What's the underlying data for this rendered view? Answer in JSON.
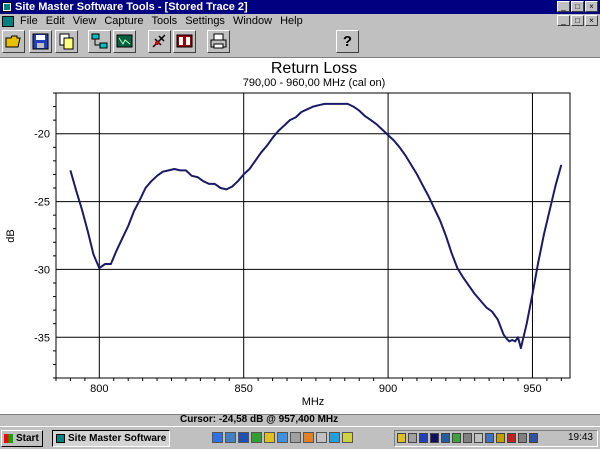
{
  "window": {
    "title": "Site Master Software Tools - [Stored Trace 2]"
  },
  "menu": {
    "items": [
      "File",
      "Edit",
      "View",
      "Capture",
      "Tools",
      "Settings",
      "Window",
      "Help"
    ]
  },
  "toolbar": {
    "buttons": [
      "open-folder-icon",
      "save-disk-icon",
      "copy-icon",
      "network-icon",
      "display-icon",
      "satellite-icon",
      "record-icon",
      "print-icon"
    ],
    "help_label": "?"
  },
  "chart_data": {
    "type": "line",
    "title": "Return Loss",
    "subtitle": "790,00 - 960,00 MHz (cal on)",
    "xlabel": "MHz",
    "ylabel": "dB",
    "xlim": [
      785,
      963
    ],
    "ylim": [
      -38,
      -17
    ],
    "xticks": [
      800,
      850,
      900,
      950
    ],
    "yticks": [
      -20,
      -25,
      -30,
      -35
    ],
    "grid": true,
    "line_color": "#1a1a66",
    "series": [
      {
        "x": [
          790,
          792,
          794,
          796,
          798,
          800,
          802,
          804,
          806,
          808,
          810,
          812,
          814,
          816,
          818,
          820,
          822,
          824,
          826,
          828,
          830,
          832,
          834,
          836,
          838,
          840,
          842,
          844,
          846,
          848,
          850,
          852,
          854,
          856,
          858,
          860,
          862,
          864,
          866,
          868,
          870,
          872,
          874,
          876,
          878,
          880,
          882,
          884,
          886,
          888,
          890,
          892,
          894,
          896,
          898,
          900,
          902,
          904,
          906,
          908,
          910,
          912,
          914,
          916,
          918,
          920,
          922,
          924,
          926,
          928,
          930,
          932,
          934,
          936,
          938,
          940,
          941,
          942,
          943,
          944,
          945,
          946,
          948,
          950,
          952,
          954,
          956,
          958,
          960
        ],
        "y": [
          -22.7,
          -24.2,
          -25.6,
          -27.2,
          -28.9,
          -29.9,
          -29.6,
          -29.6,
          -28.6,
          -27.7,
          -26.8,
          -25.7,
          -24.9,
          -24.0,
          -23.5,
          -23.1,
          -22.8,
          -22.7,
          -22.6,
          -22.7,
          -22.7,
          -23.1,
          -23.2,
          -23.5,
          -23.7,
          -23.7,
          -24.0,
          -24.1,
          -23.9,
          -23.5,
          -23.0,
          -22.6,
          -22.0,
          -21.4,
          -20.9,
          -20.3,
          -19.8,
          -19.4,
          -19.0,
          -18.8,
          -18.4,
          -18.2,
          -18.0,
          -17.9,
          -17.8,
          -17.8,
          -17.8,
          -17.8,
          -17.8,
          -18.0,
          -18.3,
          -18.7,
          -19.0,
          -19.3,
          -19.7,
          -20.1,
          -20.5,
          -21.0,
          -21.6,
          -22.3,
          -23.0,
          -23.8,
          -24.6,
          -25.5,
          -26.4,
          -27.5,
          -28.8,
          -29.9,
          -30.6,
          -31.2,
          -31.8,
          -32.3,
          -32.8,
          -33.1,
          -33.7,
          -34.8,
          -35.1,
          -35.3,
          -35.2,
          -35.3,
          -35.0,
          -35.8,
          -34.0,
          -31.8,
          -29.5,
          -27.4,
          -25.6,
          -23.8,
          -22.3
        ]
      }
    ]
  },
  "status": {
    "cursor_text": "Cursor:   -24,58 dB @ 957,400 MHz"
  },
  "taskbar": {
    "start_label": "Start",
    "task_label": "Site Master Software ...",
    "clock": "19:43"
  }
}
